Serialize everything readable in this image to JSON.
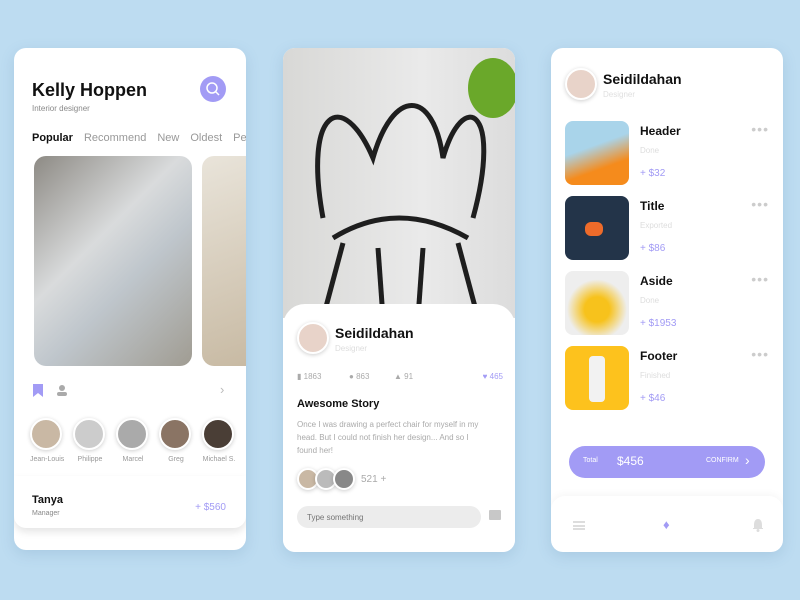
{
  "colors": {
    "accent": "#a29bf5",
    "background": "#bddcf1"
  },
  "card1": {
    "title": "Kelly Hoppen",
    "subtitle": "Interior designer",
    "search_icon": "search-icon",
    "tabs": [
      "Popular",
      "Recommend",
      "New",
      "Oldest",
      "Peop"
    ],
    "people": [
      "Jean-Louis",
      "Philippe",
      "Marcel",
      "Greg",
      "Michael S."
    ],
    "footer": {
      "name": "Tanya",
      "role": "Manager",
      "amount": "+ $560"
    }
  },
  "card2": {
    "name": "Seidildahan",
    "role": "Designer",
    "stats": {
      "saves": "1863",
      "followers": "863",
      "likes": "91",
      "hearts": "465"
    },
    "story_title": "Awesome Story",
    "story_text": "Once I was drawing a perfect chair for myself in my head. But I could not finish her design... And so I found her!",
    "participants": "521 +",
    "input_placeholder": "Type something"
  },
  "card3": {
    "name": "Seidildahan",
    "role": "Designer",
    "items": [
      {
        "title": "Header",
        "status": "Done",
        "amount": "+ $32"
      },
      {
        "title": "Title",
        "status": "Exported",
        "amount": "+ $86"
      },
      {
        "title": "Aside",
        "status": "Done",
        "amount": "+ $1953"
      },
      {
        "title": "Footer",
        "status": "Finished",
        "amount": "+ $46"
      }
    ],
    "total_label": "Total",
    "total": "$456",
    "confirm": "CONFIRM"
  }
}
